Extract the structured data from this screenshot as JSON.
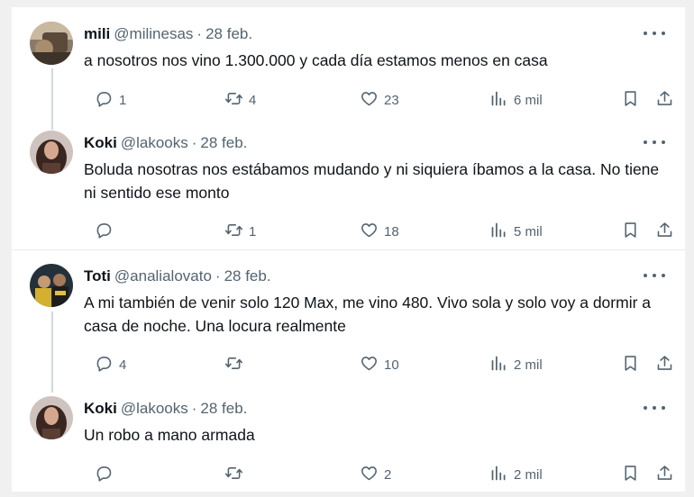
{
  "tweets": [
    {
      "name": "mili",
      "handle": "@milinesas",
      "date": "28 feb.",
      "text": "a nosotros nos vino 1.300.000 y cada día estamos menos en casa",
      "replies": "1",
      "retweets": "4",
      "likes": "23",
      "views": "6 mil"
    },
    {
      "name": "Koki",
      "handle": "@lakooks",
      "date": "28 feb.",
      "text": "Boluda nosotras nos estábamos mudando y ni siquiera íbamos a la casa. No tiene ni sentido ese monto",
      "replies": "",
      "retweets": "1",
      "likes": "18",
      "views": "5 mil"
    },
    {
      "name": "Toti",
      "handle": "@analialovato",
      "date": "28 feb.",
      "text": "A mi también de venir solo 120 Max, me vino 480. Vivo sola y solo voy a dormir a casa de noche. Una locura realmente",
      "replies": "4",
      "retweets": "",
      "likes": "10",
      "views": "2 mil"
    },
    {
      "name": "Koki",
      "handle": "@lakooks",
      "date": "28 feb.",
      "text": "Un robo a mano armada",
      "replies": "",
      "retweets": "",
      "likes": "2",
      "views": "2 mil"
    }
  ],
  "separator": "·",
  "icons": {
    "reply": "reply-icon",
    "retweet": "retweet-icon",
    "like": "heart-icon",
    "views": "views-icon",
    "bookmark": "bookmark-icon",
    "share": "share-icon",
    "more": "more-icon"
  },
  "colors": {
    "text": "#0f1419",
    "secondary": "#536471",
    "thread_line": "#cfd9de",
    "divider": "#e6ecf0"
  }
}
